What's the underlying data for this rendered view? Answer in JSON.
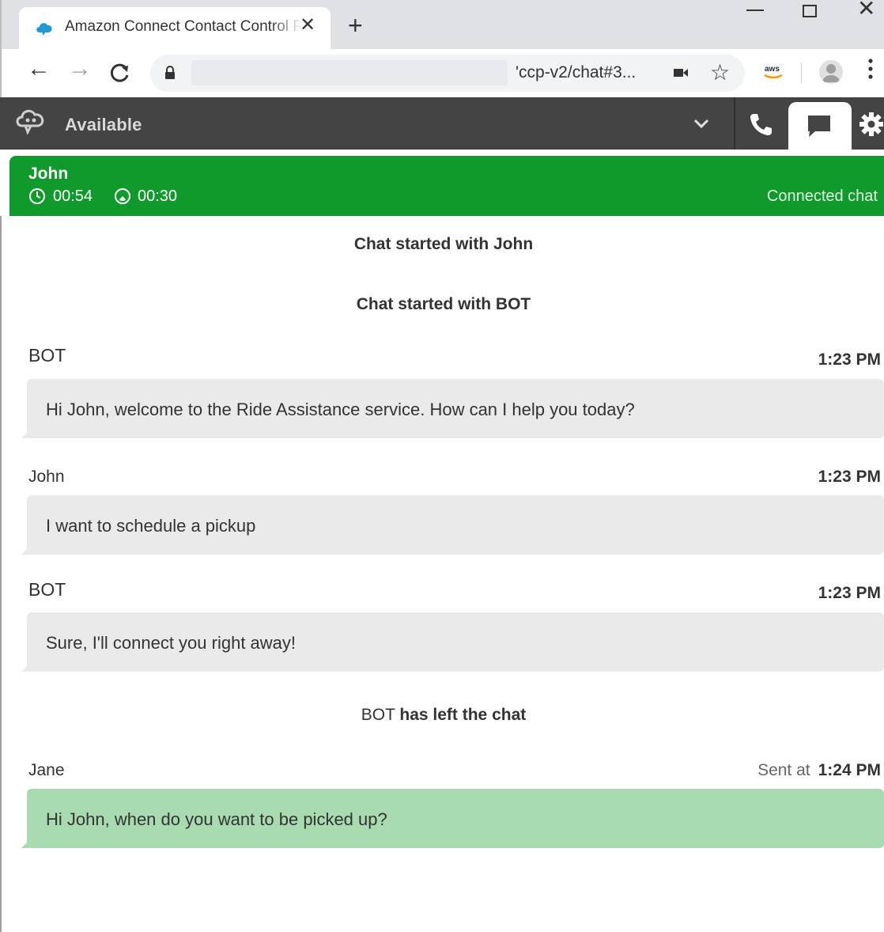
{
  "browser": {
    "tab_title": "Amazon Connect Contact Control Panel",
    "close_tab_glyph": "✕",
    "new_tab_glyph": "+",
    "url_visible": "'ccp-v2/chat#3...",
    "icons": [
      "amazon-connect-favicon",
      "back-arrow-icon",
      "forward-arrow-icon",
      "reload-icon",
      "lock-icon",
      "camera-icon",
      "star-icon",
      "amazon-extension-icon",
      "profile-icon",
      "menu-icon"
    ]
  },
  "ccp": {
    "status": "Available",
    "header_icons": [
      "connect-logo-icon",
      "chevron-down-icon",
      "phone-icon",
      "chat-icon",
      "gear-icon"
    ]
  },
  "contact": {
    "name": "John",
    "elapsed_time": "00:54",
    "state_time": "00:30",
    "state": "Connected chat"
  },
  "transcript": {
    "system_1": "Chat started with  John",
    "system_2": "Chat started with BOT",
    "system_3_name": "BOT",
    "system_3_text": "has left the chat",
    "messages": [
      {
        "sender": "BOT",
        "time": "1:23 PM",
        "text": "Hi John, welcome to the Ride Assistance service. How can I help you today?"
      },
      {
        "sender": "John",
        "time": "1:23 PM",
        "text": "I want to schedule a pickup"
      },
      {
        "sender": "BOT",
        "time": "1:23 PM",
        "text": "Sure, I'll connect you right away!"
      },
      {
        "sender": "Jane",
        "sent_label": "Sent at",
        "time": "1:24 PM",
        "text": "Hi John, when do you want to be picked up?"
      }
    ]
  },
  "colors": {
    "header": "#444444",
    "connected_banner": "#0f9a2b",
    "customer_bubble": "#eaeaea",
    "agent_bubble": "#a8dcb0"
  }
}
